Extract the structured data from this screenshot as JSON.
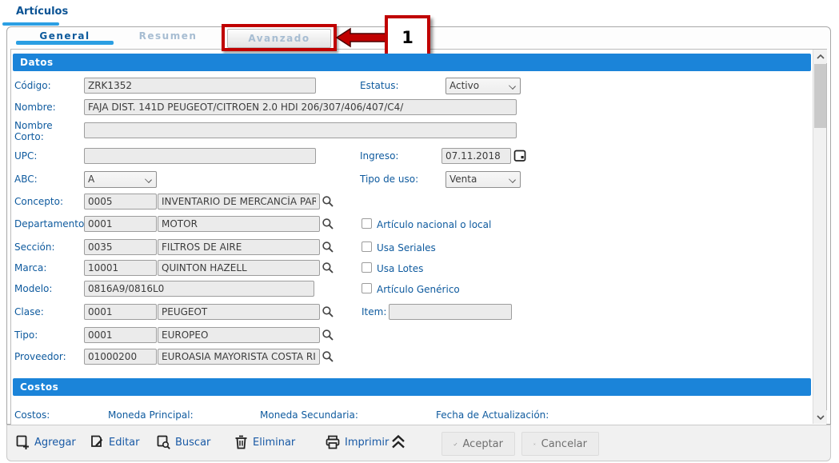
{
  "window": {
    "title": "Artículos"
  },
  "tabs": {
    "general": "General",
    "resumen": "Resumen",
    "avanzado": "Avanzado"
  },
  "annotation": {
    "callout_number": "1",
    "highlight_color": "#c00000"
  },
  "sections": {
    "datos": "Datos",
    "costos": "Costos"
  },
  "fields": {
    "codigo": {
      "label": "Código:",
      "value": "ZRK1352"
    },
    "estatus": {
      "label": "Estatus:",
      "value": "Activo"
    },
    "nombre": {
      "label": "Nombre:",
      "value": "FAJA DIST. 141D PEUGEOT/CITROEN 2.0 HDI 206/307/406/407/C4/"
    },
    "nombre_corto": {
      "label_line1": "Nombre",
      "label_line2": "Corto:",
      "value": ""
    },
    "upc": {
      "label": "UPC:",
      "value": ""
    },
    "ingreso": {
      "label": "Ingreso:",
      "value": "07.11.2018"
    },
    "abc": {
      "label": "ABC:",
      "value": "A"
    },
    "tipo_de_uso": {
      "label": "Tipo de uso:",
      "value": "Venta"
    },
    "concepto": {
      "label": "Concepto:",
      "code": "0005",
      "desc": "INVENTARIO DE MERCANCÍA PAR"
    },
    "departamento": {
      "label": "Departamento:",
      "code": "0001",
      "desc": "MOTOR"
    },
    "seccion": {
      "label": "Sección:",
      "code": "0035",
      "desc": "FILTROS DE AIRE"
    },
    "marca": {
      "label": "Marca:",
      "code": "10001",
      "desc": "QUINTON HAZELL"
    },
    "modelo": {
      "label": "Modelo:",
      "value": "0816A9/0816L0"
    },
    "clase": {
      "label": "Clase:",
      "code": "0001",
      "desc": "PEUGEOT"
    },
    "tipo": {
      "label": "Tipo:",
      "code": "0001",
      "desc": "EUROPEO"
    },
    "proveedor": {
      "label": "Proveedor:",
      "code": "01000200",
      "desc": "EUROASIA MAYORISTA COSTA RI"
    },
    "item": {
      "label": "Item:",
      "value": ""
    }
  },
  "checkboxes": [
    {
      "label": "Artículo nacional o local",
      "checked": false
    },
    {
      "label": "Usa Seriales",
      "checked": false
    },
    {
      "label": "Usa Lotes",
      "checked": false
    },
    {
      "label": "Artículo Genérico",
      "checked": false
    }
  ],
  "costos_row": {
    "costos": "Costos:",
    "moneda_principal": "Moneda Principal:",
    "moneda_secundaria": "Moneda Secundaria:",
    "fecha_actualizacion": "Fecha de Actualización:"
  },
  "toolbar": {
    "agregar": "Agregar",
    "editar": "Editar",
    "buscar": "Buscar",
    "eliminar": "Eliminar",
    "imprimir": "Imprimir",
    "aceptar": "Aceptar",
    "cancelar": "Cancelar"
  },
  "colors": {
    "section_header": "#1b84d9",
    "label_blue": "#0e5a9e",
    "active_tab_underline": "#2b9fe3",
    "inactive_tab_text": "#a7bdd2",
    "annotation_red": "#c00000",
    "toolbar_link": "#1859a5"
  }
}
